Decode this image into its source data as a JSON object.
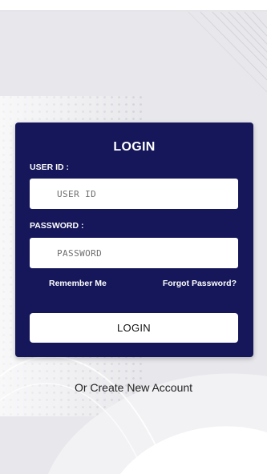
{
  "login_card": {
    "title": "LOGIN",
    "user_id_label": "USER ID :",
    "user_id_placeholder": "USER ID",
    "password_label": "PASSWORD :",
    "password_placeholder": "PASSWORD",
    "remember_me": "Remember Me",
    "forgot_password": "Forgot Password?",
    "login_button": "LOGIN"
  },
  "footer": {
    "create_account": "Or Create New Account"
  },
  "colors": {
    "card_background": "#16175a",
    "page_background": "#e6e6ea",
    "button_background": "#ffffff"
  }
}
